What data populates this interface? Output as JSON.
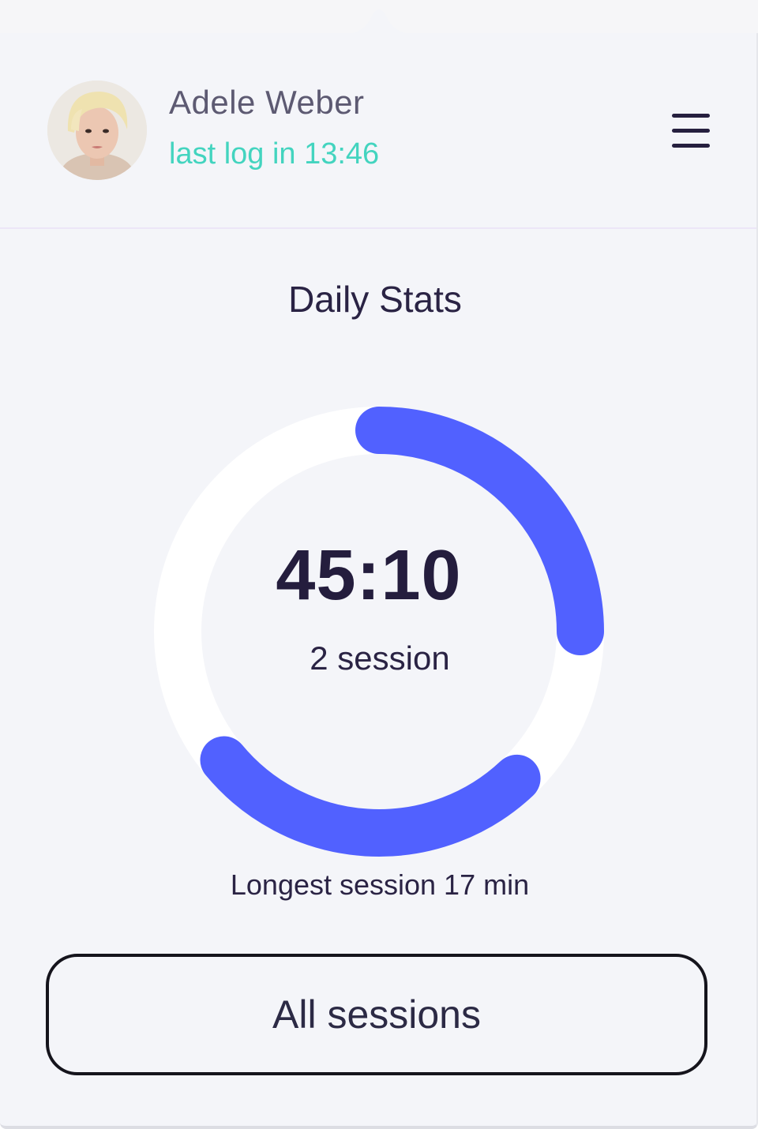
{
  "header": {
    "user_name": "Adele Weber",
    "last_log": "last log in 13:46"
  },
  "stats": {
    "title": "Daily Stats",
    "time_value": "45:10",
    "session_count": "2 session",
    "longest_session": "Longest session 17 min",
    "progress_arcs": [
      {
        "start_fraction": 0.0,
        "end_fraction": 0.25
      },
      {
        "start_fraction": 0.38,
        "end_fraction": 0.64
      }
    ]
  },
  "actions": {
    "all_sessions_label": "All sessions"
  },
  "colors": {
    "accent": "#5161ff",
    "teal": "#43d4bf",
    "ring_track": "#ffffff",
    "background": "#f4f5f9",
    "text_dark": "#241d3d"
  }
}
